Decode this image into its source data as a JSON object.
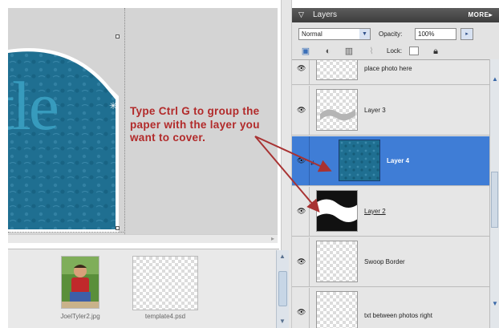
{
  "canvas": {
    "document_text": "tle",
    "annotation": "Type Ctrl G to group the paper with the layer you want to cover."
  },
  "photo_bin": {
    "items": [
      {
        "label": "JoelTyler2.jpg"
      },
      {
        "label": "template4.psd"
      }
    ]
  },
  "layers_palette": {
    "title": "Layers",
    "more_label": "MORE▸",
    "blend_mode": "Normal",
    "opacity_label": "Opacity:",
    "opacity_value": "100%",
    "lock_label": "Lock:",
    "layers": [
      {
        "name": "place photo here",
        "visible": true,
        "selected": false
      },
      {
        "name": "Layer 3",
        "visible": true,
        "selected": false
      },
      {
        "name": "Layer 4",
        "visible": true,
        "selected": true
      },
      {
        "name": "Layer 2",
        "visible": true,
        "selected": false
      },
      {
        "name": "Swoop Border",
        "visible": true,
        "selected": false
      },
      {
        "name": "txt between photos right",
        "visible": true,
        "selected": false
      }
    ]
  },
  "colors": {
    "selection": "#3f7dd6",
    "annotation": "#b22a2a",
    "paper": "#1f6f91",
    "palette_header": "#4a4a4a"
  }
}
